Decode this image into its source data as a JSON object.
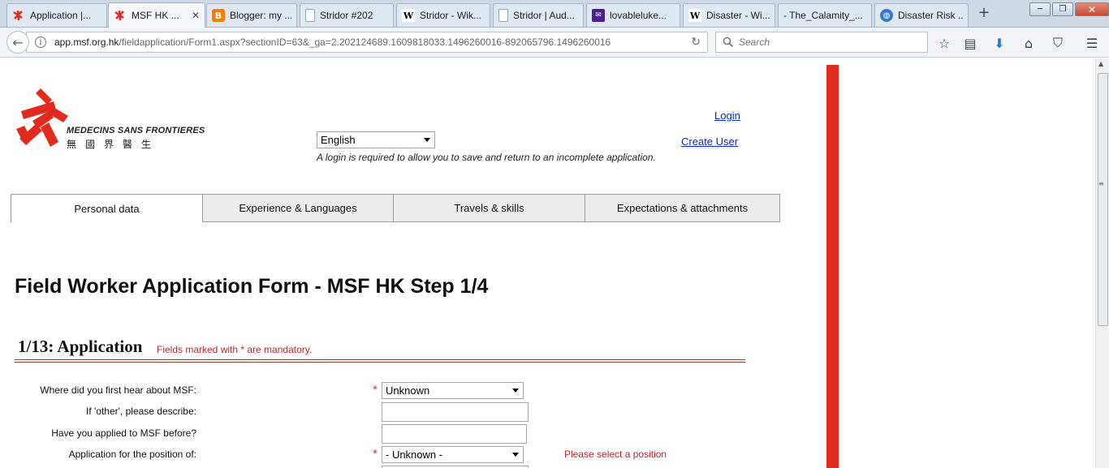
{
  "browser": {
    "tabs": [
      {
        "label": "Application |...",
        "icon": "msf-icon",
        "active": false
      },
      {
        "label": "MSF HK ...",
        "icon": "msf-icon",
        "active": true
      },
      {
        "label": "Blogger: my ...",
        "icon": "blogger-icon",
        "active": false
      },
      {
        "label": "Stridor #202",
        "icon": "document-icon",
        "active": false
      },
      {
        "label": "Stridor - Wik...",
        "icon": "wikipedia-icon",
        "active": false
      },
      {
        "label": "Stridor | Aud...",
        "icon": "document-icon",
        "active": false
      },
      {
        "label": "lovableluke...",
        "icon": "mail-icon",
        "active": false
      },
      {
        "label": "Disaster - Wi...",
        "icon": "wikipedia-icon",
        "active": false
      },
      {
        "label": "- The_Calamity_...",
        "icon": "blank-page-icon",
        "active": false
      },
      {
        "label": "Disaster Risk ...",
        "icon": "globe-icon",
        "active": false
      }
    ],
    "new_tab": "+",
    "url_host": "app.msf.org.hk",
    "url_prefix": "",
    "url_path": "/fieldapplication/Form1.aspx?sectionID=63&_ga=2.202124689.1609818033.1496260016-892065796.1496260016",
    "search_placeholder": "Search"
  },
  "header": {
    "logo_text": "MEDECINS SANS FRONTIERES",
    "logo_chinese": "無國界醫生",
    "language": "English",
    "login_link": "Login",
    "create_user_link": "Create User",
    "login_note": "A login is required to allow you to save and return to an incomplete application."
  },
  "steps": [
    {
      "label": "Personal data",
      "active": true
    },
    {
      "label": "Experience & Languages",
      "active": false
    },
    {
      "label": "Travels & skills",
      "active": false
    },
    {
      "label": "Expectations & attachments",
      "active": false
    }
  ],
  "form": {
    "title": "Field Worker Application Form - MSF HK Step 1/4",
    "section_title": "1/13: Application",
    "mandatory_note": "Fields marked with * are mandatory.",
    "fields": {
      "hear_about": {
        "label": "Where did you first hear about MSF:",
        "value": "Unknown",
        "required": "*"
      },
      "other_describe": {
        "label": "If 'other', please describe:",
        "value": ""
      },
      "applied_before": {
        "label": "Have you applied to MSF before?",
        "value": ""
      },
      "position": {
        "label": "Application for the position of:",
        "value": "- Unknown -",
        "required": "*",
        "error": "Please select a position"
      }
    }
  },
  "colors": {
    "brand_red": "#e22b1e",
    "error_red": "#c0252a",
    "link_blue": "#0a2ab8"
  }
}
